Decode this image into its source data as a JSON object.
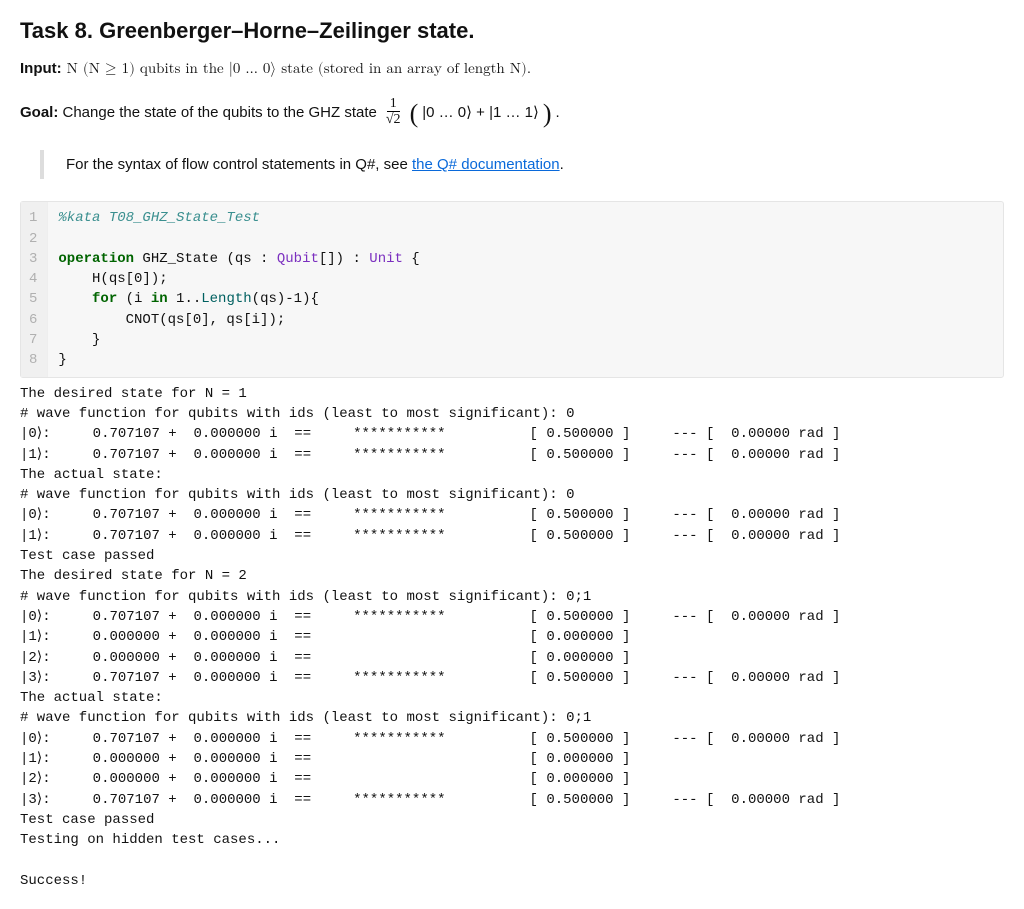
{
  "task": {
    "title": "Task 8. Greenberger–Horne–Zeilinger state.",
    "input_label": "Input:",
    "input_text_1": " N (N ≥ 1) qubits in the ",
    "input_text_2": " state (stored in an array of length N).",
    "input_ket": "|0 … 0⟩",
    "goal_label": "Goal:",
    "goal_text": " Change the state of the qubits to the GHZ state ",
    "goal_ket": "|0 … 0⟩ + |1 … 1⟩",
    "frac_num": "1",
    "frac_den": "√2",
    "period": "."
  },
  "note": {
    "prefix": "For the syntax of flow control statements in Q#, see ",
    "link_text": "the Q# documentation",
    "suffix": "."
  },
  "code": {
    "line_numbers": [
      "1",
      "2",
      "3",
      "4",
      "5",
      "6",
      "7",
      "8"
    ],
    "l1_comment": "%kata T08_GHZ_State_Test",
    "l3_kw1": "operation",
    "l3_name": " GHZ_State (qs : ",
    "l3_type": "Qubit",
    "l3_rest": "[]) : ",
    "l3_unit": "Unit",
    "l3_brace": " {",
    "l4": "    H(qs[0]);",
    "l5_for": "    for",
    "l5_mid": " (i ",
    "l5_in": "in",
    "l5_range": " 1..",
    "l5_len": "Length",
    "l5_rest": "(qs)-1){",
    "l6": "        CNOT(qs[0], qs[i]);",
    "l7": "    }",
    "l8": "}"
  },
  "output": "The desired state for N = 1\n# wave function for qubits with ids (least to most significant): 0\n|0⟩:     0.707107 +  0.000000 i  ==     ***********          [ 0.500000 ]     --- [  0.00000 rad ]\n|1⟩:     0.707107 +  0.000000 i  ==     ***********          [ 0.500000 ]     --- [  0.00000 rad ]\nThe actual state:\n# wave function for qubits with ids (least to most significant): 0\n|0⟩:     0.707107 +  0.000000 i  ==     ***********          [ 0.500000 ]     --- [  0.00000 rad ]\n|1⟩:     0.707107 +  0.000000 i  ==     ***********          [ 0.500000 ]     --- [  0.00000 rad ]\nTest case passed\nThe desired state for N = 2\n# wave function for qubits with ids (least to most significant): 0;1\n|0⟩:     0.707107 +  0.000000 i  ==     ***********          [ 0.500000 ]     --- [  0.00000 rad ]\n|1⟩:     0.000000 +  0.000000 i  ==                          [ 0.000000 ]\n|2⟩:     0.000000 +  0.000000 i  ==                          [ 0.000000 ]\n|3⟩:     0.707107 +  0.000000 i  ==     ***********          [ 0.500000 ]     --- [  0.00000 rad ]\nThe actual state:\n# wave function for qubits with ids (least to most significant): 0;1\n|0⟩:     0.707107 +  0.000000 i  ==     ***********          [ 0.500000 ]     --- [  0.00000 rad ]\n|1⟩:     0.000000 +  0.000000 i  ==                          [ 0.000000 ]\n|2⟩:     0.000000 +  0.000000 i  ==                          [ 0.000000 ]\n|3⟩:     0.707107 +  0.000000 i  ==     ***********          [ 0.500000 ]     --- [  0.00000 rad ]\nTest case passed\nTesting on hidden test cases...\n\nSuccess!"
}
